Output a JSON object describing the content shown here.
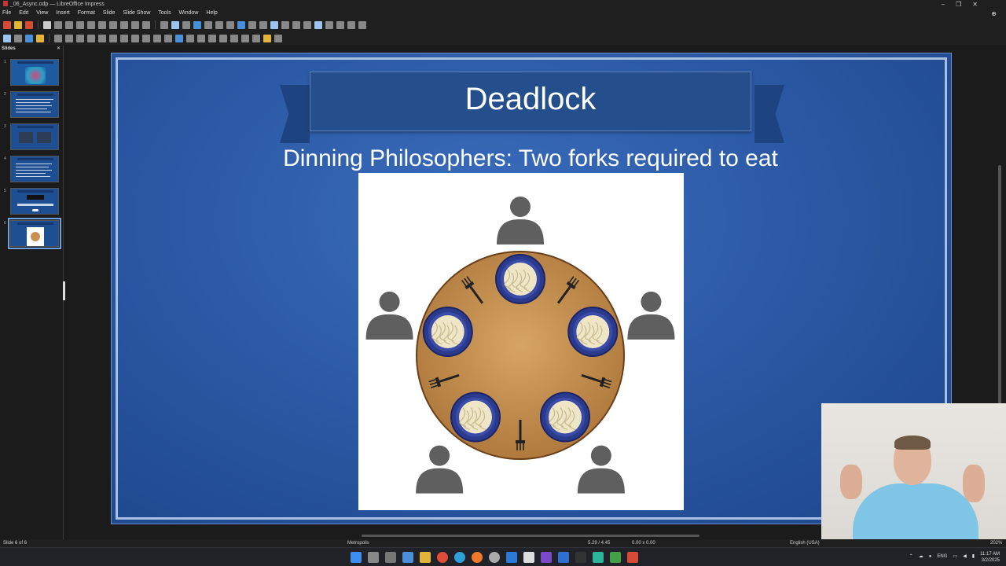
{
  "window": {
    "title": "_06_Async.odp — LibreOffice Impress",
    "controls": [
      "–",
      "❐",
      "✕"
    ]
  },
  "menubar": [
    "File",
    "Edit",
    "View",
    "Insert",
    "Format",
    "Slide",
    "Slide Show",
    "Tools",
    "Window",
    "Help"
  ],
  "slide_pane": {
    "title": "Slides",
    "close": "✕",
    "slides": [
      {
        "number": "1"
      },
      {
        "number": "2"
      },
      {
        "number": "3"
      },
      {
        "number": "4"
      },
      {
        "number": "5"
      },
      {
        "number": "6",
        "active": true
      }
    ]
  },
  "slide": {
    "title": "Deadlock",
    "subtitle": "Dinning Philosophers: Two forks required to eat",
    "image": {
      "philosophers": 5,
      "plates": 5,
      "forks": 5,
      "table_color": "#c8914f",
      "plate_color": "#2a3a8c"
    }
  },
  "statusbar": {
    "slide_info": "Slide 6 of 6",
    "master": "Metropolis",
    "position": "5.29 / 4.45",
    "size": "0.00 x 0.00",
    "language": "English (USA)",
    "zoom": "202%"
  },
  "taskbar": {
    "lang": "ENG",
    "time": "11:17 AM",
    "date": "3/2/2025"
  },
  "colors": {
    "slide_bg": "#2c5aa6",
    "banner": "#244f8c",
    "chrome": "#1f1f1f"
  }
}
